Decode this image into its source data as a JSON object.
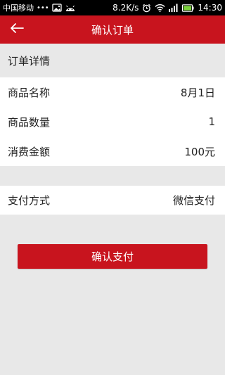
{
  "status_bar": {
    "carrier": "中国移动",
    "dots": "•••",
    "speed": "8.2K/s",
    "time": "14:30",
    "icons": [
      "image-icon",
      "android-icon",
      "alarm-icon",
      "wifi-icon",
      "signal-icon",
      "battery-icon"
    ]
  },
  "header": {
    "title": "确认订单",
    "back_icon": "back-arrow-icon",
    "color": "#c8141e"
  },
  "details": {
    "section_title": "订单详情",
    "rows": [
      {
        "label": "商品名称",
        "value": "8月1日"
      },
      {
        "label": "商品数量",
        "value": "1"
      },
      {
        "label": "消费金额",
        "value": "100元"
      }
    ]
  },
  "payment": {
    "label": "支付方式",
    "value": "微信支付"
  },
  "confirm_button": {
    "label": "确认支付"
  }
}
